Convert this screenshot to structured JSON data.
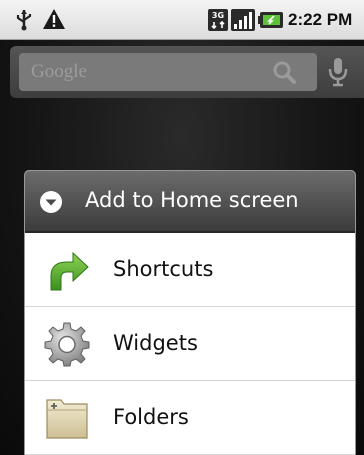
{
  "status_bar": {
    "time": "2:22 PM",
    "network_label": "3G",
    "icons": [
      "usb-icon",
      "warning-icon",
      "3g-icon",
      "signal-icon",
      "battery-icon"
    ]
  },
  "search": {
    "placeholder": "Google",
    "icons": [
      "search-icon",
      "mic-icon"
    ]
  },
  "dialog": {
    "title": "Add to Home screen",
    "header_icon": "menu-circle-icon",
    "items": [
      {
        "label": "Shortcuts",
        "icon": "shortcut-arrow-icon"
      },
      {
        "label": "Widgets",
        "icon": "gear-icon"
      },
      {
        "label": "Folders",
        "icon": "folder-icon"
      }
    ]
  },
  "colors": {
    "status_bar_bg": "#e8e8e8",
    "dialog_header_bg": "#4a4a4a",
    "shortcut_green": "#4ea82a"
  }
}
